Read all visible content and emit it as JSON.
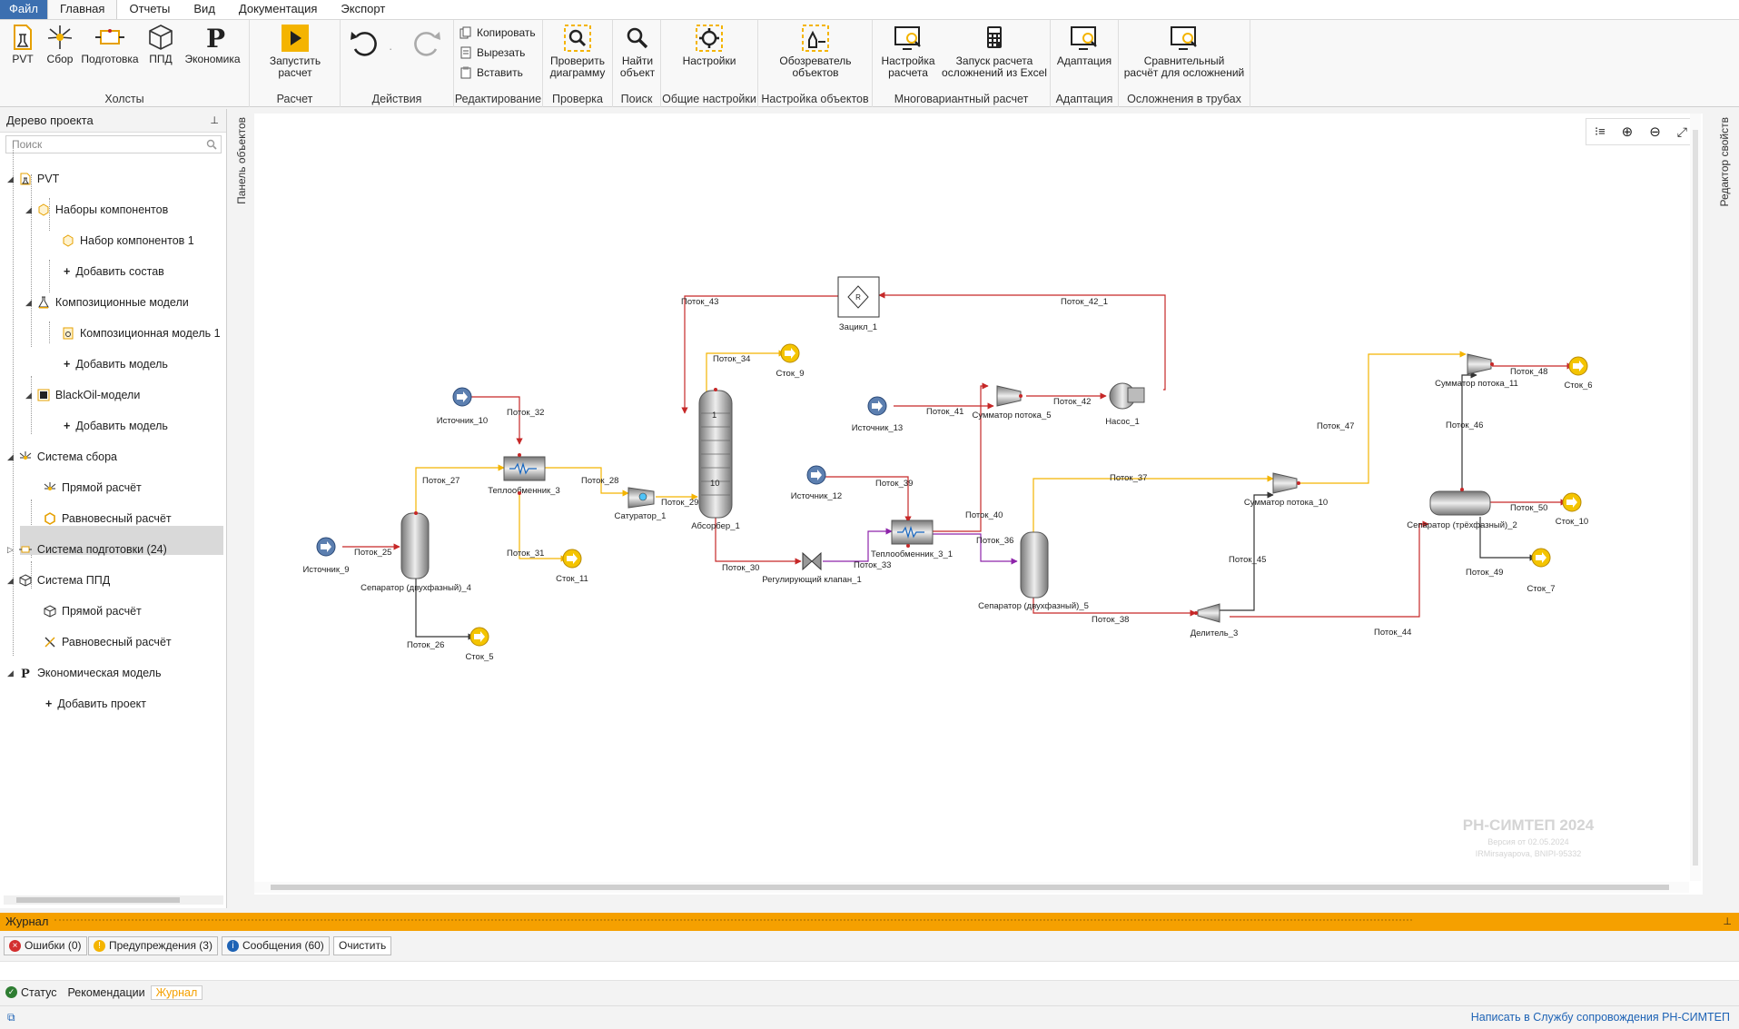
{
  "menu": {
    "tabs": [
      "Файл",
      "Главная",
      "Отчеты",
      "Вид",
      "Документация",
      "Экспорт"
    ]
  },
  "ribbon": {
    "groups": {
      "canvases": "Холсты",
      "calc": "Расчет",
      "actions": "Действия",
      "edit": "Редактирование",
      "check": "Проверка",
      "search": "Поиск",
      "settings": "Общие настройки",
      "objsettings": "Настройка объектов",
      "multivar": "Многовариантный расчет",
      "adapt": "Адаптация",
      "pipes": "Осложнения в трубах"
    },
    "buttons": {
      "pvt": "PVT",
      "sbor": "Сбор",
      "podg": "Подготовка",
      "ppd": "ППД",
      "econ": "Экономика",
      "run1": "Запустить",
      "run2": "расчет",
      "copy": "Копировать",
      "cut": "Вырезать",
      "paste": "Вставить",
      "check1": "Проверить",
      "check2": "диаграмму",
      "find1": "Найти",
      "find2": "объект",
      "settings": "Настройки",
      "obs1": "Обозреватель",
      "obs2": "объектов",
      "mv1": "Настройка",
      "mv2": "расчета",
      "mv3": "Запуск расчета",
      "mv4": "осложнений из Excel",
      "adapt": "Адаптация",
      "cmp1": "Сравнительный",
      "cmp2": "расчёт для осложнений"
    }
  },
  "tree": {
    "title": "Дерево проекта",
    "search_placeholder": "Поиск",
    "items": [
      {
        "label": "PVT"
      },
      {
        "label": "Наборы компонентов"
      },
      {
        "label": "Набор компонентов 1"
      },
      {
        "label": "Добавить состав"
      },
      {
        "label": "Композиционные модели"
      },
      {
        "label": "Композиционная модель 1"
      },
      {
        "label": "Добавить модель"
      },
      {
        "label": "BlackOil-модели"
      },
      {
        "label": "Добавить модель"
      },
      {
        "label": "Система сбора"
      },
      {
        "label": "Прямой расчёт"
      },
      {
        "label": "Равновесный расчёт"
      },
      {
        "label": "Система подготовки (24)"
      },
      {
        "label": "Система ППД"
      },
      {
        "label": "Прямой расчёт"
      },
      {
        "label": "Равновесный расчёт"
      },
      {
        "label": "Экономическая модель"
      },
      {
        "label": "Добавить проект"
      }
    ]
  },
  "side": {
    "objects_panel": "Панель объектов",
    "props_editor": "Редактор свойств"
  },
  "diagram": {
    "nodes": {
      "zacikl": "Зацикл_1",
      "src10": "Источник_10",
      "src9": "Источник_9",
      "src13": "Источник_13",
      "src12": "Источник_12",
      "hx3": "Теплообменник_3",
      "hx31": "Теплообменник_3_1",
      "sat": "Сатуратор_1",
      "abs": "Абсорбер_1",
      "sep4": "Сепаратор (двухфазный)_4",
      "sep5": "Сепаратор (двухфазный)_5",
      "sep2": "Сепаратор (трёхфазный)_2",
      "stok9": "Сток_9",
      "stok11": "Сток_11",
      "stok5": "Сток_5",
      "stok6": "Сток_6",
      "stok10": "Сток_10",
      "stok7": "Сток_7",
      "sum5": "Сумматор потока_5",
      "sum10": "Сумматор потока_10",
      "sum11": "Сумматор потока_11",
      "pump": "Насос_1",
      "valve": "Регулирующий клапан_1",
      "div3": "Делитель_3",
      "abs_top": "1",
      "abs_bot": "10",
      "zacikl_r": "R"
    },
    "streams": {
      "p43": "Поток_43",
      "p42_1": "Поток_42_1",
      "p34": "Поток_34",
      "p32": "Поток_32",
      "p27": "Поток_27",
      "p28": "Поток_28",
      "p29": "Поток_29",
      "p31": "Поток_31",
      "p25": "Поток_25",
      "p26": "Поток_26",
      "p30": "Поток_30",
      "p33": "Поток_33",
      "p41": "Поток_41",
      "p42": "Поток_42",
      "p39": "Поток_39",
      "p40": "Поток_40",
      "p36": "Поток_36",
      "p37": "Поток_37",
      "p38": "Поток_38",
      "p45": "Поток_45",
      "p47": "Поток_47",
      "p46": "Поток_46",
      "p48": "Поток_48",
      "p50": "Поток_50",
      "p49": "Поток_49",
      "p44": "Поток_44"
    },
    "watermark": {
      "title": "РН-СИМТЕП 2024",
      "version": "Версия от 02.05.2024",
      "user": "IRMirsayapova, BNIPI-95332"
    }
  },
  "journal": {
    "title": "Журнал",
    "errors": "Ошибки (0)",
    "warnings": "Предупреждения (3)",
    "messages": "Сообщения (60)",
    "clear": "Очистить",
    "status": "Статус",
    "recs": "Рекомендации",
    "journal": "Журнал"
  },
  "footer": {
    "support": "Написать в Службу сопровождения РН-СИМТЕП"
  },
  "colors": {
    "accent": "#f5a000",
    "file_tab": "#3c6fb0",
    "stream_red": "#c62828",
    "stream_orange": "#f4b400",
    "stream_purple": "#8e24aa",
    "selection": "#d9d9d9"
  }
}
